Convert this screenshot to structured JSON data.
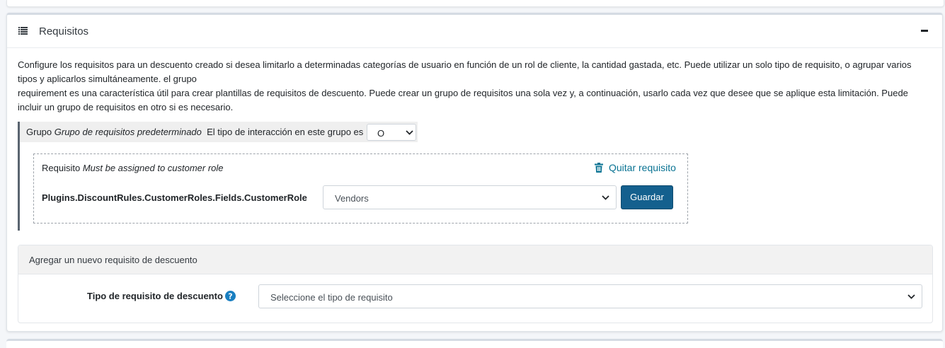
{
  "card": {
    "title": "Requisitos",
    "icon": "list-icon",
    "collapse_icon": "minus-icon"
  },
  "description": {
    "line1": "Configure los requisitos para un descuento creado si desea limitarlo a determinadas categorías de usuario en función de un rol de cliente, la cantidad gastada, etc. Puede utilizar un solo tipo de requisito, o agrupar varios tipos y aplicarlos simultáneamente. el grupo",
    "line2": "requirement es una característica útil para crear plantillas de requisitos de descuento. Puede crear un grupo de requisitos una sola vez y, a continuación, usarlo cada vez que desee que se aplique esta limitación. Puede incluir un grupo de requisitos en otro si es necesario."
  },
  "group": {
    "prefix": "Grupo",
    "name": "Grupo de requisitos predeterminado",
    "interaction_label": "El tipo de interacción en este grupo es",
    "interaction_value": "O"
  },
  "requirement": {
    "prefix": "Requisito",
    "name": "Must be assigned to customer role",
    "remove_label": "Quitar requisito",
    "field_label": "Plugins.DiscountRules.CustomerRoles.Fields.CustomerRole",
    "role_value": "Vendors",
    "save_label": "Guardar"
  },
  "add_requirement": {
    "title": "Agregar un nuevo requisito de descuento",
    "type_label": "Tipo de requisito de descuento",
    "type_placeholder": "Seleccione el tipo de requisito"
  },
  "colors": {
    "link": "#0a7393",
    "primary_button": "#14608e",
    "help_icon": "#1a7fc1"
  }
}
